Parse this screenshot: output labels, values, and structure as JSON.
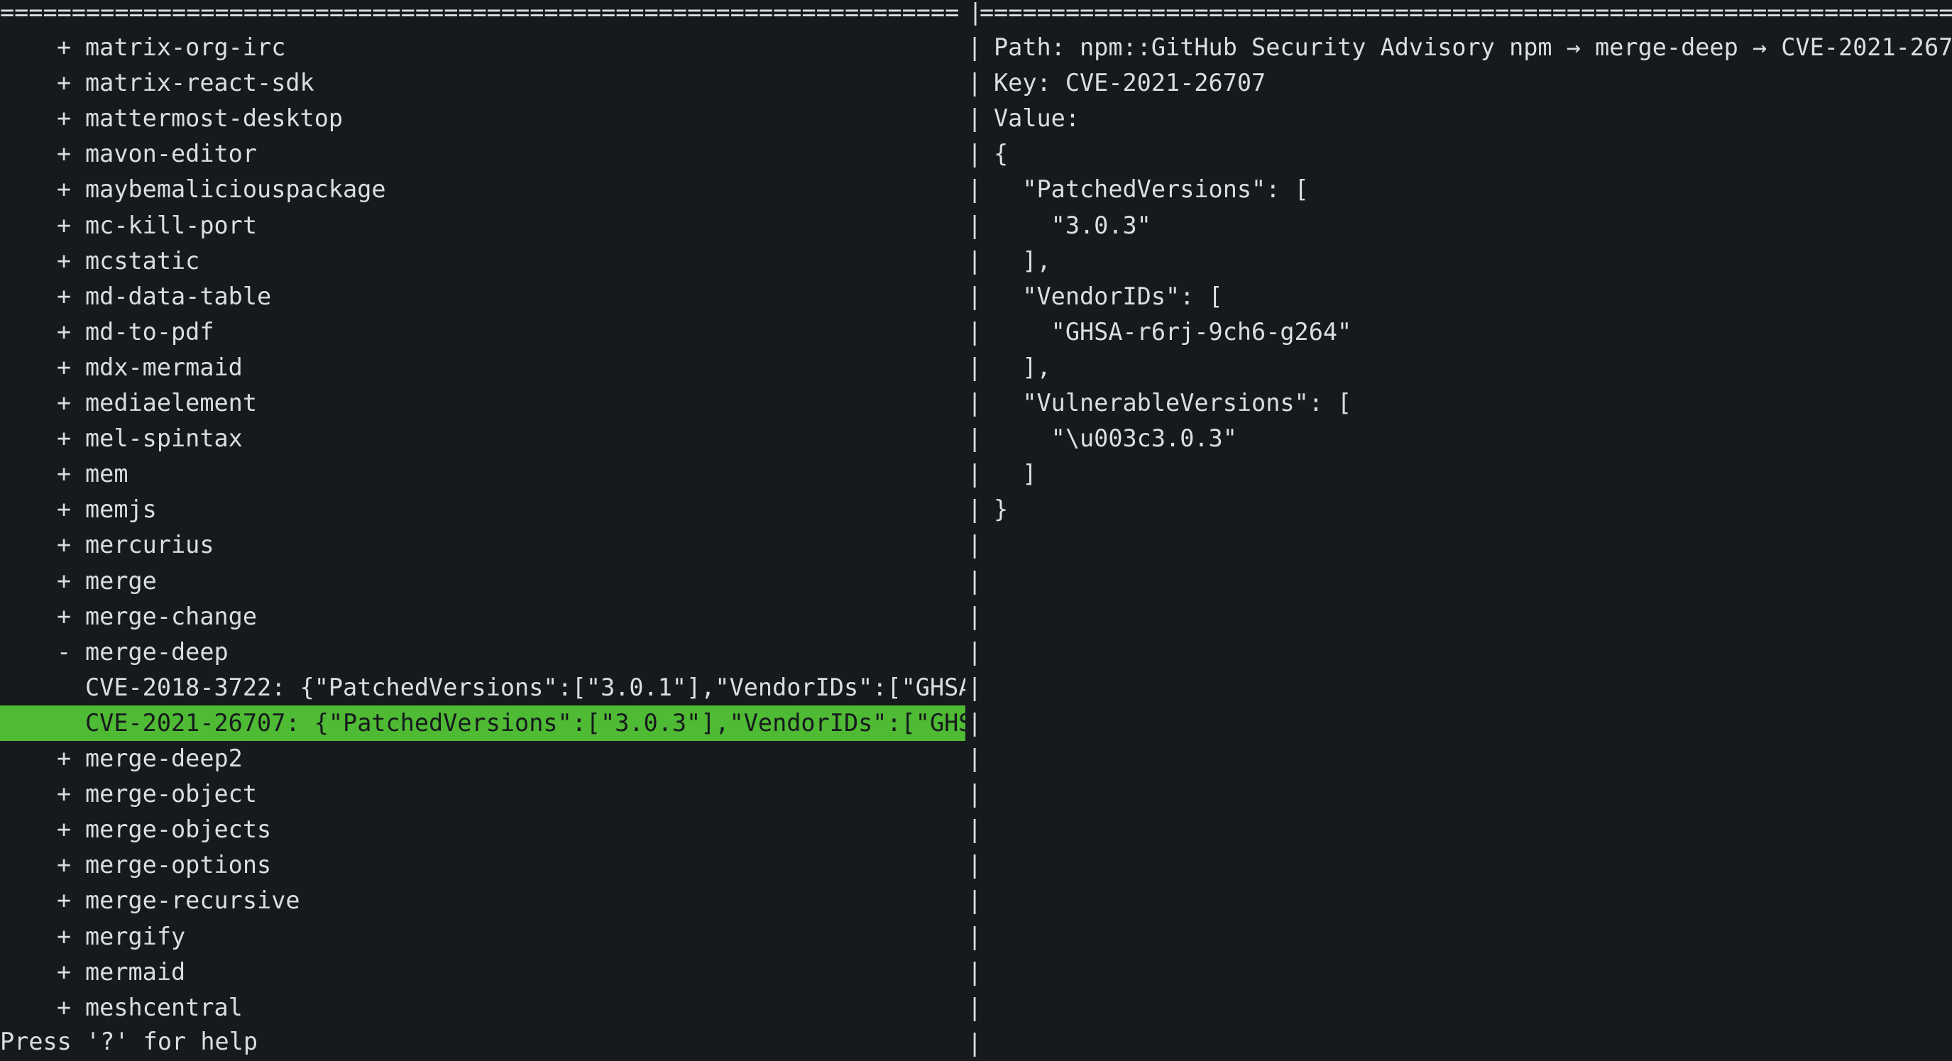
{
  "header": {
    "left_rule": "===================================================================",
    "right_rule": "============================================================================="
  },
  "tree": {
    "items": [
      {
        "marker": "+",
        "label": "matrix-org-irc"
      },
      {
        "marker": "+",
        "label": "matrix-react-sdk"
      },
      {
        "marker": "+",
        "label": "mattermost-desktop"
      },
      {
        "marker": "+",
        "label": "mavon-editor"
      },
      {
        "marker": "+",
        "label": "maybemaliciouspackage"
      },
      {
        "marker": "+",
        "label": "mc-kill-port"
      },
      {
        "marker": "+",
        "label": "mcstatic"
      },
      {
        "marker": "+",
        "label": "md-data-table"
      },
      {
        "marker": "+",
        "label": "md-to-pdf"
      },
      {
        "marker": "+",
        "label": "mdx-mermaid"
      },
      {
        "marker": "+",
        "label": "mediaelement"
      },
      {
        "marker": "+",
        "label": "mel-spintax"
      },
      {
        "marker": "+",
        "label": "mem"
      },
      {
        "marker": "+",
        "label": "memjs"
      },
      {
        "marker": "+",
        "label": "mercurius"
      },
      {
        "marker": "+",
        "label": "merge"
      },
      {
        "marker": "+",
        "label": "merge-change"
      },
      {
        "marker": "-",
        "label": "merge-deep"
      },
      {
        "marker": "",
        "label": "CVE-2018-3722: {\"PatchedVersions\":[\"3.0.1\"],\"VendorIDs\":[\"GHSA"
      },
      {
        "marker": "",
        "label": "CVE-2021-26707: {\"PatchedVersions\":[\"3.0.3\"],\"VendorIDs\":[\"GHS"
      },
      {
        "marker": "+",
        "label": "merge-deep2"
      },
      {
        "marker": "+",
        "label": "merge-object"
      },
      {
        "marker": "+",
        "label": "merge-objects"
      },
      {
        "marker": "+",
        "label": "merge-options"
      },
      {
        "marker": "+",
        "label": "merge-recursive"
      },
      {
        "marker": "+",
        "label": "mergify"
      },
      {
        "marker": "+",
        "label": "mermaid"
      },
      {
        "marker": "+",
        "label": "meshcentral"
      }
    ],
    "selected_index": 19
  },
  "detail": {
    "lines": [
      "Path: npm::GitHub Security Advisory npm → merge-deep → CVE-2021-267",
      "Key: CVE-2021-26707",
      "Value:",
      "{",
      "  \"PatchedVersions\": [",
      "    \"3.0.3\"",
      "  ],",
      "  \"VendorIDs\": [",
      "    \"GHSA-r6rj-9ch6-g264\"",
      "  ],",
      "  \"VulnerableVersions\": [",
      "    \"\\u003c3.0.3\"",
      "  ]",
      "}"
    ]
  },
  "divider_char": "|",
  "status": {
    "help_text": "Press '?' for help"
  },
  "colors": {
    "background": "#16191d",
    "foreground": "#dadde1",
    "selection": "#4fba34"
  }
}
